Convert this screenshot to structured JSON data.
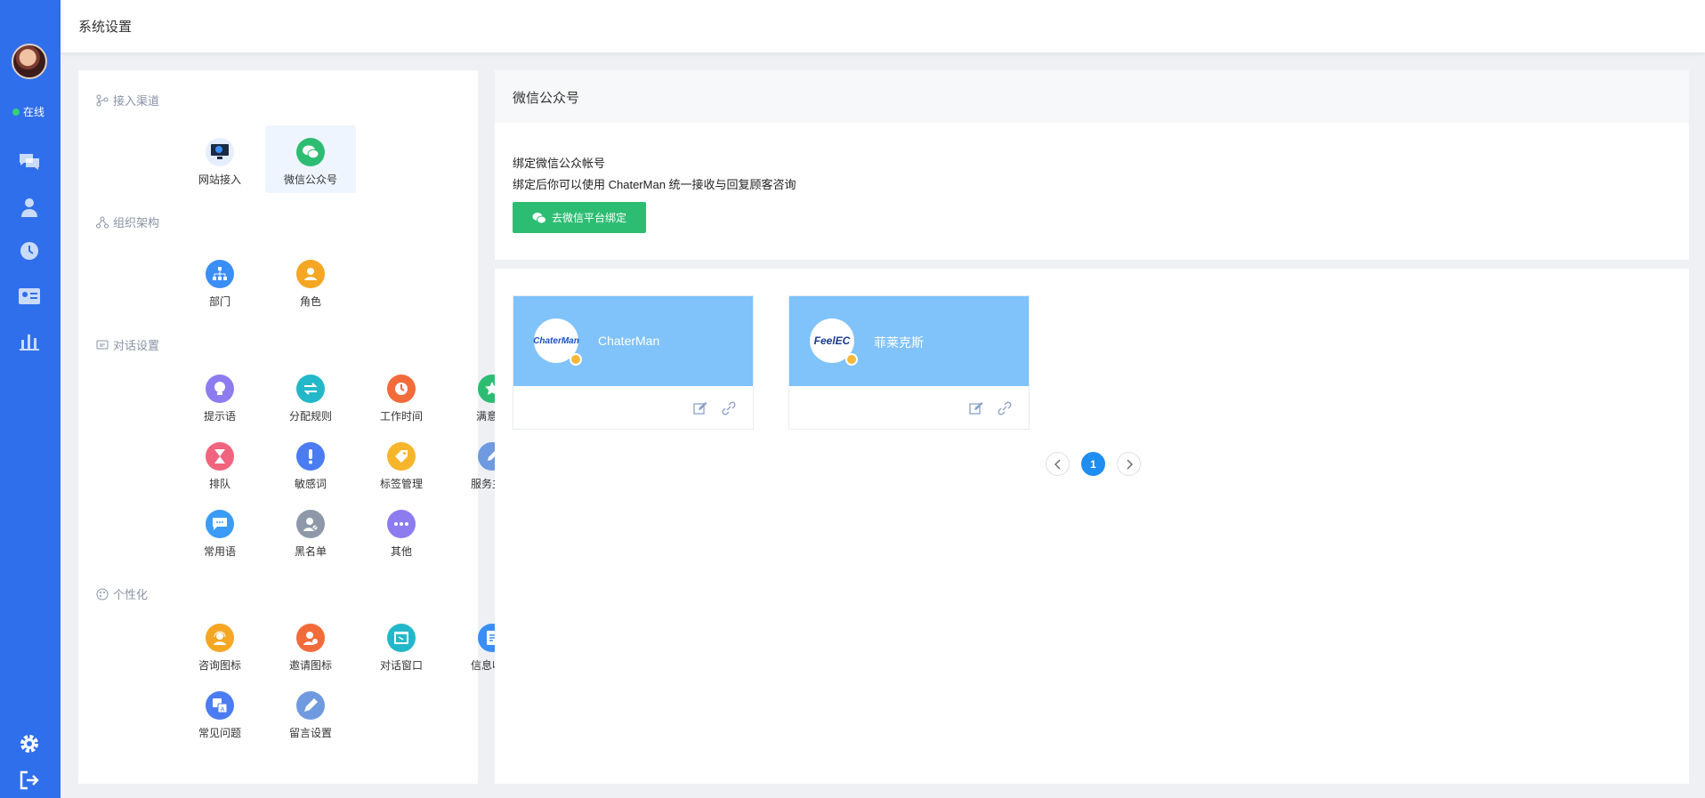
{
  "topbar": {
    "title": "系统设置"
  },
  "rail": {
    "status": "在线",
    "icons": [
      "chat-icon",
      "customer-icon",
      "history-icon",
      "contact-card-icon",
      "stats-icon",
      "settings-icon",
      "logout-icon"
    ]
  },
  "sections": {
    "channels": {
      "title": "接入渠道",
      "items": [
        {
          "label": "网站接入",
          "icon": "monitor-icon"
        },
        {
          "label": "微信公众号",
          "icon": "wechat-icon"
        }
      ]
    },
    "org": {
      "title": "组织架构",
      "items": [
        {
          "label": "部门",
          "icon": "org-tree-icon"
        },
        {
          "label": "角色",
          "icon": "role-icon"
        }
      ]
    },
    "dialog": {
      "title": "对话设置",
      "items": [
        {
          "label": "提示语",
          "icon": "bulb-icon"
        },
        {
          "label": "分配规则",
          "icon": "swap-icon"
        },
        {
          "label": "工作时间",
          "icon": "clock-icon"
        },
        {
          "label": "满意度",
          "icon": "star-icon"
        },
        {
          "label": "排队",
          "icon": "hourglass-icon"
        },
        {
          "label": "敏感词",
          "icon": "exclamation-icon"
        },
        {
          "label": "标签管理",
          "icon": "tag-icon"
        },
        {
          "label": "服务主题",
          "icon": "pencil-icon"
        },
        {
          "label": "常用语",
          "icon": "message-icon"
        },
        {
          "label": "黑名单",
          "icon": "blacklist-icon"
        },
        {
          "label": "其他",
          "icon": "more-icon"
        }
      ]
    },
    "personal": {
      "title": "个性化",
      "items": [
        {
          "label": "咨询图标",
          "icon": "consult-icon"
        },
        {
          "label": "邀请图标",
          "icon": "invite-icon"
        },
        {
          "label": "对话窗口",
          "icon": "window-icon"
        },
        {
          "label": "信息收集",
          "icon": "form-icon"
        },
        {
          "label": "常见问题",
          "icon": "faq-icon"
        },
        {
          "label": "留言设置",
          "icon": "note-icon"
        }
      ]
    }
  },
  "wechat": {
    "header": "微信公众号",
    "line1": "绑定微信公众帐号",
    "line2": "绑定后你可以使用 ChaterMan 统一接收与回复顾客咨询",
    "button": "去微信平台绑定"
  },
  "accounts": [
    {
      "name": "ChaterMan",
      "logo_text": "ChaterMan"
    },
    {
      "name": "菲莱克斯",
      "logo_text": "FeelEC"
    }
  ],
  "pagination": {
    "current": "1"
  },
  "colors": {
    "rail": "#2f6fec",
    "accent_green": "#2dbd72",
    "card_header": "#80c2fa",
    "page_active": "#1f8ef1"
  }
}
